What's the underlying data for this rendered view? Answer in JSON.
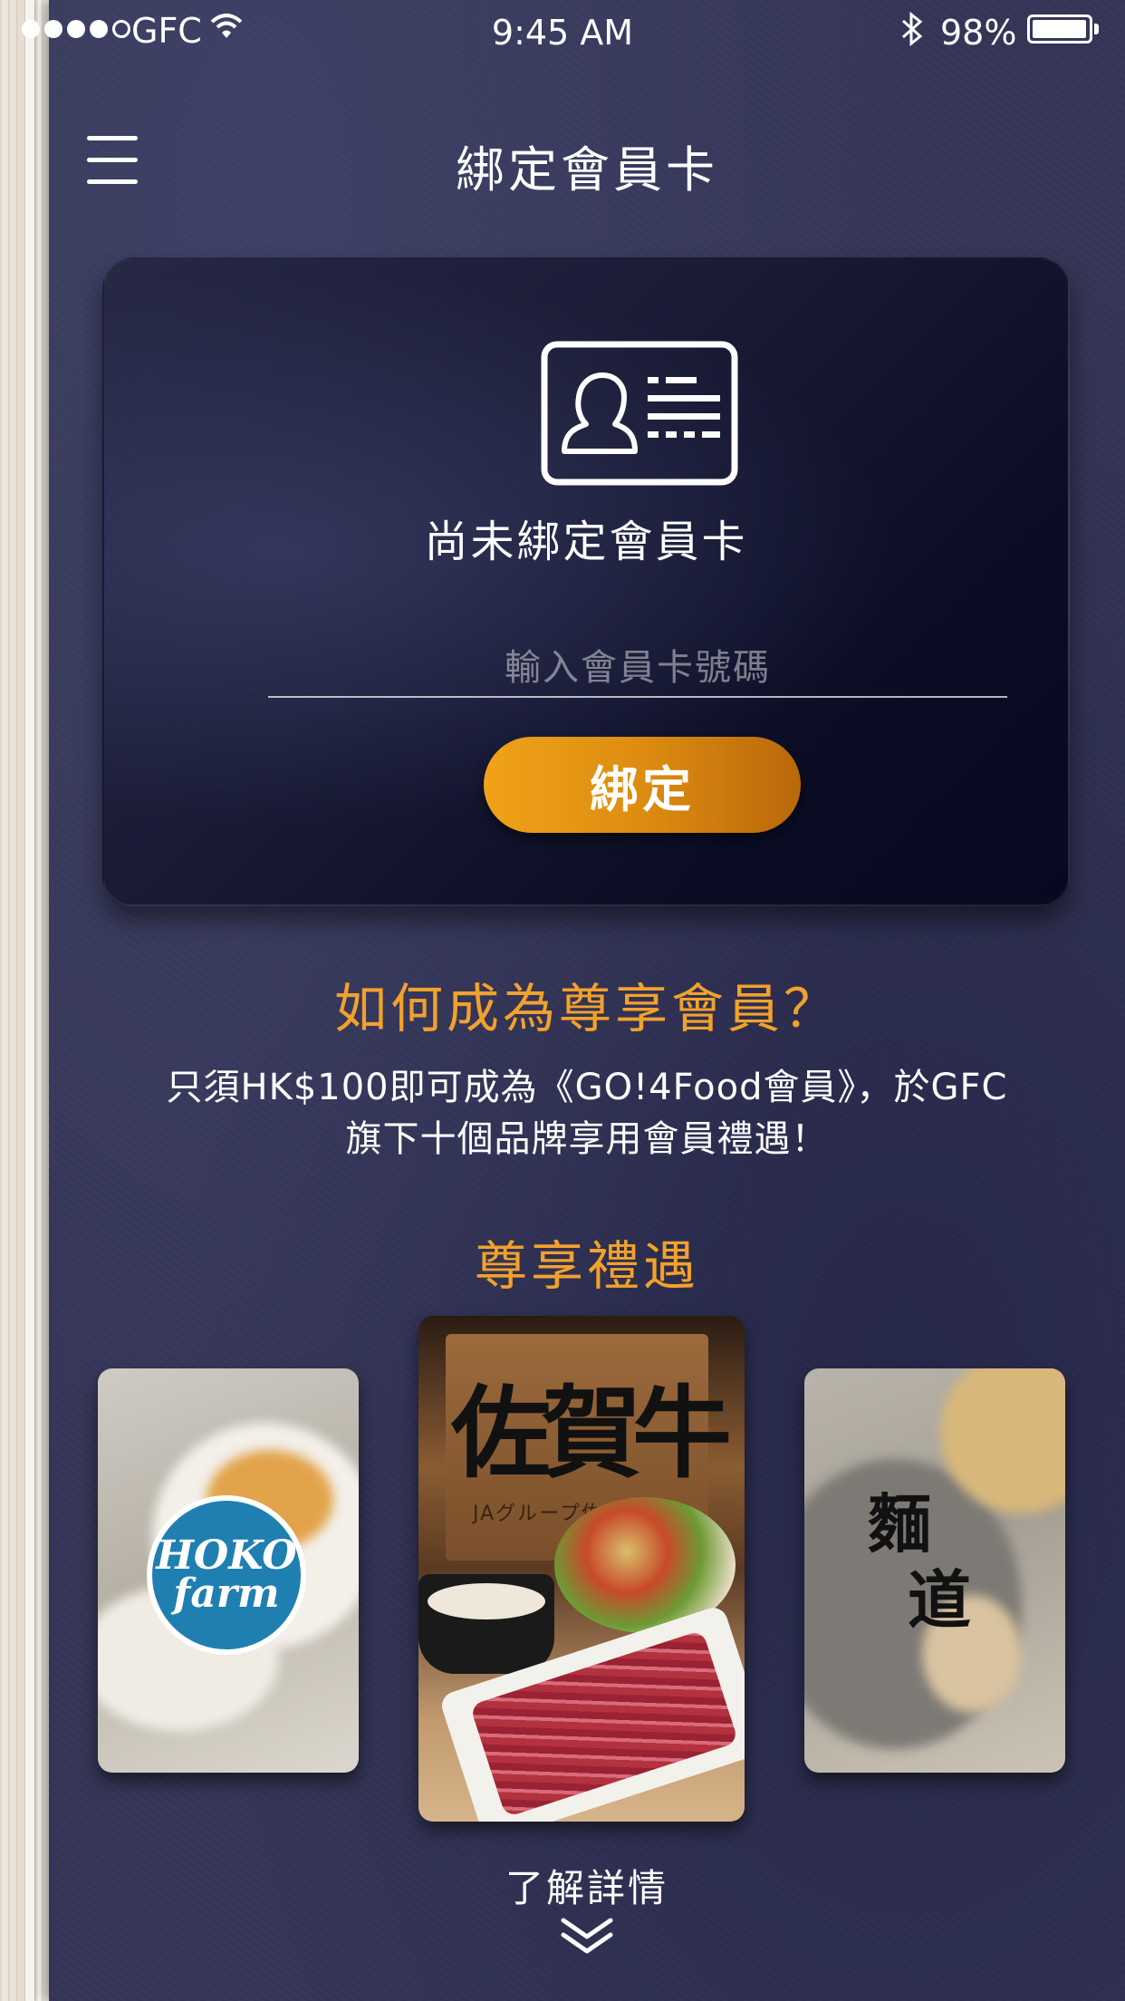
{
  "status_bar": {
    "carrier": "GFC",
    "time": "9:45 AM",
    "battery": "98%",
    "battery_level": 0.98,
    "signal_bars_filled": 4,
    "signal_bars_total": 5
  },
  "nav": {
    "title": "綁定會員卡",
    "menu_icon": "hamburger-menu-icon"
  },
  "card": {
    "icon": "member-card-icon",
    "status_text": "尚未綁定會員卡",
    "input_placeholder": "輸入會員卡號碼",
    "input_value": "",
    "bind_label": "綁定"
  },
  "info": {
    "title": "如何成為尊享會員？",
    "description_line1": "只須HK$100即可成為《GO!4Food會員》，於GFC",
    "description_line2": "旗下十個品牌享用會員禮遇！"
  },
  "benefits": {
    "title": "尊享禮遇",
    "brands": [
      {
        "logo_line1": "HOKO",
        "logo_line2": "farm"
      },
      {
        "sign_text": "佐賀牛",
        "sign_small": "JAグループ佐賀"
      },
      {
        "logo_line1": "麵",
        "logo_line2": "道"
      }
    ]
  },
  "more": {
    "label": "了解詳情",
    "icon": "double-chevron-down-icon"
  },
  "colors": {
    "accent": "#f2a12c",
    "background": "#343556",
    "button_start": "#f0a219",
    "button_end": "#b9680b"
  }
}
